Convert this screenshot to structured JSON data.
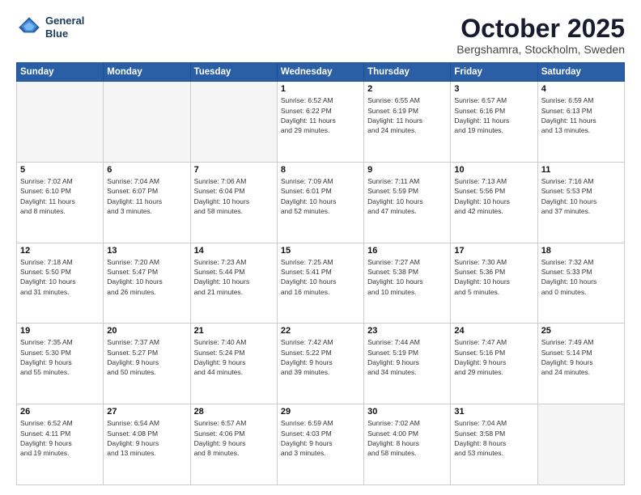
{
  "header": {
    "logo_line1": "General",
    "logo_line2": "Blue",
    "month": "October 2025",
    "location": "Bergshamra, Stockholm, Sweden"
  },
  "days_of_week": [
    "Sunday",
    "Monday",
    "Tuesday",
    "Wednesday",
    "Thursday",
    "Friday",
    "Saturday"
  ],
  "weeks": [
    [
      {
        "day": "",
        "info": ""
      },
      {
        "day": "",
        "info": ""
      },
      {
        "day": "",
        "info": ""
      },
      {
        "day": "1",
        "info": "Sunrise: 6:52 AM\nSunset: 6:22 PM\nDaylight: 11 hours\nand 29 minutes."
      },
      {
        "day": "2",
        "info": "Sunrise: 6:55 AM\nSunset: 6:19 PM\nDaylight: 11 hours\nand 24 minutes."
      },
      {
        "day": "3",
        "info": "Sunrise: 6:57 AM\nSunset: 6:16 PM\nDaylight: 11 hours\nand 19 minutes."
      },
      {
        "day": "4",
        "info": "Sunrise: 6:59 AM\nSunset: 6:13 PM\nDaylight: 11 hours\nand 13 minutes."
      }
    ],
    [
      {
        "day": "5",
        "info": "Sunrise: 7:02 AM\nSunset: 6:10 PM\nDaylight: 11 hours\nand 8 minutes."
      },
      {
        "day": "6",
        "info": "Sunrise: 7:04 AM\nSunset: 6:07 PM\nDaylight: 11 hours\nand 3 minutes."
      },
      {
        "day": "7",
        "info": "Sunrise: 7:06 AM\nSunset: 6:04 PM\nDaylight: 10 hours\nand 58 minutes."
      },
      {
        "day": "8",
        "info": "Sunrise: 7:09 AM\nSunset: 6:01 PM\nDaylight: 10 hours\nand 52 minutes."
      },
      {
        "day": "9",
        "info": "Sunrise: 7:11 AM\nSunset: 5:59 PM\nDaylight: 10 hours\nand 47 minutes."
      },
      {
        "day": "10",
        "info": "Sunrise: 7:13 AM\nSunset: 5:56 PM\nDaylight: 10 hours\nand 42 minutes."
      },
      {
        "day": "11",
        "info": "Sunrise: 7:16 AM\nSunset: 5:53 PM\nDaylight: 10 hours\nand 37 minutes."
      }
    ],
    [
      {
        "day": "12",
        "info": "Sunrise: 7:18 AM\nSunset: 5:50 PM\nDaylight: 10 hours\nand 31 minutes."
      },
      {
        "day": "13",
        "info": "Sunrise: 7:20 AM\nSunset: 5:47 PM\nDaylight: 10 hours\nand 26 minutes."
      },
      {
        "day": "14",
        "info": "Sunrise: 7:23 AM\nSunset: 5:44 PM\nDaylight: 10 hours\nand 21 minutes."
      },
      {
        "day": "15",
        "info": "Sunrise: 7:25 AM\nSunset: 5:41 PM\nDaylight: 10 hours\nand 16 minutes."
      },
      {
        "day": "16",
        "info": "Sunrise: 7:27 AM\nSunset: 5:38 PM\nDaylight: 10 hours\nand 10 minutes."
      },
      {
        "day": "17",
        "info": "Sunrise: 7:30 AM\nSunset: 5:36 PM\nDaylight: 10 hours\nand 5 minutes."
      },
      {
        "day": "18",
        "info": "Sunrise: 7:32 AM\nSunset: 5:33 PM\nDaylight: 10 hours\nand 0 minutes."
      }
    ],
    [
      {
        "day": "19",
        "info": "Sunrise: 7:35 AM\nSunset: 5:30 PM\nDaylight: 9 hours\nand 55 minutes."
      },
      {
        "day": "20",
        "info": "Sunrise: 7:37 AM\nSunset: 5:27 PM\nDaylight: 9 hours\nand 50 minutes."
      },
      {
        "day": "21",
        "info": "Sunrise: 7:40 AM\nSunset: 5:24 PM\nDaylight: 9 hours\nand 44 minutes."
      },
      {
        "day": "22",
        "info": "Sunrise: 7:42 AM\nSunset: 5:22 PM\nDaylight: 9 hours\nand 39 minutes."
      },
      {
        "day": "23",
        "info": "Sunrise: 7:44 AM\nSunset: 5:19 PM\nDaylight: 9 hours\nand 34 minutes."
      },
      {
        "day": "24",
        "info": "Sunrise: 7:47 AM\nSunset: 5:16 PM\nDaylight: 9 hours\nand 29 minutes."
      },
      {
        "day": "25",
        "info": "Sunrise: 7:49 AM\nSunset: 5:14 PM\nDaylight: 9 hours\nand 24 minutes."
      }
    ],
    [
      {
        "day": "26",
        "info": "Sunrise: 6:52 AM\nSunset: 4:11 PM\nDaylight: 9 hours\nand 19 minutes."
      },
      {
        "day": "27",
        "info": "Sunrise: 6:54 AM\nSunset: 4:08 PM\nDaylight: 9 hours\nand 13 minutes."
      },
      {
        "day": "28",
        "info": "Sunrise: 6:57 AM\nSunset: 4:06 PM\nDaylight: 9 hours\nand 8 minutes."
      },
      {
        "day": "29",
        "info": "Sunrise: 6:59 AM\nSunset: 4:03 PM\nDaylight: 9 hours\nand 3 minutes."
      },
      {
        "day": "30",
        "info": "Sunrise: 7:02 AM\nSunset: 4:00 PM\nDaylight: 8 hours\nand 58 minutes."
      },
      {
        "day": "31",
        "info": "Sunrise: 7:04 AM\nSunset: 3:58 PM\nDaylight: 8 hours\nand 53 minutes."
      },
      {
        "day": "",
        "info": ""
      }
    ]
  ]
}
